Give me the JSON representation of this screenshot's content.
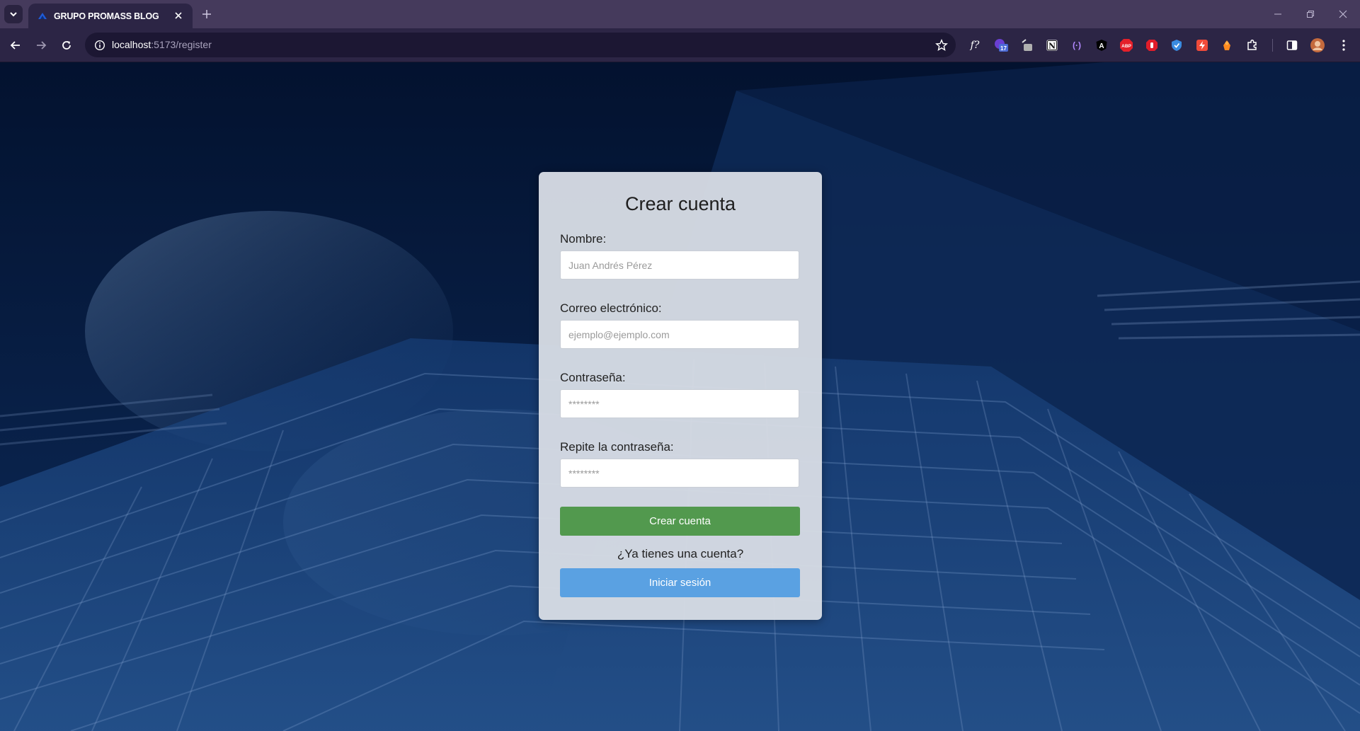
{
  "browser": {
    "tab": {
      "title": "GRUPO PROMASS BLOG"
    },
    "address_bar": {
      "host": "localhost",
      "rest": ":5173/register"
    },
    "extensions": [
      {
        "name": "formula-extension-icon",
        "label": "f?"
      },
      {
        "name": "calendar-extension-icon",
        "label": "17"
      },
      {
        "name": "camera-extension-icon",
        "label": ""
      },
      {
        "name": "notion-extension-icon",
        "label": "N"
      },
      {
        "name": "brackets-extension-icon",
        "label": "(·)"
      },
      {
        "name": "angular-extension-icon",
        "label": "A"
      },
      {
        "name": "adblock-plus-extension-icon",
        "label": "ABP"
      },
      {
        "name": "stop-hand-extension-icon",
        "label": ""
      },
      {
        "name": "shield-extension-icon",
        "label": ""
      },
      {
        "name": "bolt-extension-icon",
        "label": ""
      },
      {
        "name": "fox-extension-icon",
        "label": ""
      },
      {
        "name": "puzzle-extensions-icon",
        "label": ""
      }
    ]
  },
  "form": {
    "title": "Crear cuenta",
    "fields": [
      {
        "label": "Nombre:",
        "placeholder": "Juan Andrés Pérez"
      },
      {
        "label": "Correo electrónico:",
        "placeholder": "ejemplo@ejemplo.com"
      },
      {
        "label": "Contraseña:",
        "placeholder": "********"
      },
      {
        "label": "Repite la contraseña:",
        "placeholder": "********"
      }
    ],
    "submit_label": "Crear cuenta",
    "login_prompt": "¿Ya tienes una cuenta?",
    "login_label": "Iniciar sesión"
  },
  "colors": {
    "submit_button": "#52994e",
    "login_button": "#5aa1e2",
    "browser_frame": "#453a5c",
    "page_background": "#0b2a5a"
  }
}
